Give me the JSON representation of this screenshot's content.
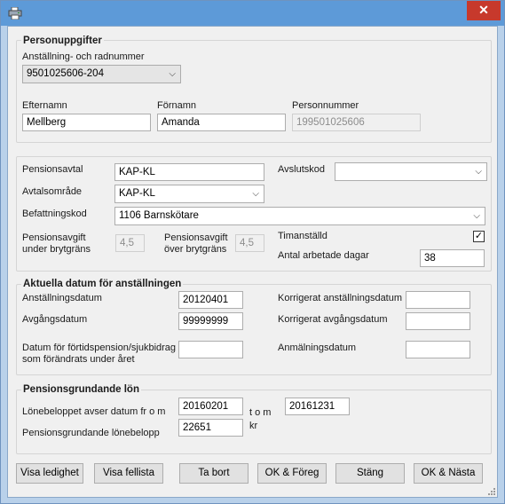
{
  "window": {
    "close_glyph": "✕",
    "app_icon": "printer-icon",
    "close_icon": "close-icon"
  },
  "personuppgifter": {
    "title": "Personuppgifter",
    "anstallning_label": "Anställning- och radnummer",
    "anstallning_value": "9501025606-204",
    "efternamn_label": "Efternamn",
    "efternamn_value": "Mellberg",
    "fornamn_label": "Förnamn",
    "fornamn_value": "Amanda",
    "personnummer_label": "Personnummer",
    "personnummer_value": "199501025606"
  },
  "pension": {
    "avtal_label": "Pensionsavtal",
    "avtal_value": "KAP-KL",
    "avslutskod_label": "Avslutskod",
    "avslutskod_value": "",
    "avtalsomrade_label": "Avtalsområde",
    "avtalsomrade_value": "KAP-KL",
    "befattning_label": "Befattningskod",
    "befattning_value": "1106 Barnskötare",
    "avgift_under_label": "Pensionsavgift under brytgräns",
    "avgift_under_value": "4,5",
    "avgift_over_label": "Pensionsavgift över brytgräns",
    "avgift_over_value": "4,5",
    "timanstalld_label": "Timanställd",
    "timanstalld_checked": true,
    "timanstalld_glyph": "✓",
    "arbetsdagar_label": "Antal arbetade dagar",
    "arbetsdagar_value": "38"
  },
  "datum": {
    "title": "Aktuella datum för anställningen",
    "anstallningsdatum_label": "Anställningsdatum",
    "anstallningsdatum_value": "20120401",
    "korr_anst_label": "Korrigerat anställningsdatum",
    "korr_anst_value": "",
    "avgangsdatum_label": "Avgångsdatum",
    "avgangsdatum_value": "99999999",
    "korr_avg_label": "Korrigerat avgångsdatum",
    "korr_avg_value": "",
    "fortidspension_label": "Datum för förtidspension/sjukbidrag som förändrats under året",
    "fortidspension_value": "",
    "anmalningsdatum_label": "Anmälningsdatum",
    "anmalningsdatum_value": ""
  },
  "lon": {
    "title": "Pensionsgrundande lön",
    "datum_from_label": "Lönebeloppet avser datum fr o m",
    "datum_from_value": "20160201",
    "tom_label": "t o m",
    "datum_tom_value": "20161231",
    "belopp_label": "Pensionsgrundande lönebelopp",
    "belopp_value": "22651",
    "kr_label": "kr"
  },
  "buttons": {
    "visa_ledighet": "Visa ledighet",
    "visa_fellista": "Visa fellista",
    "ta_bort": "Ta bort",
    "ok_foreg": "OK & Föreg",
    "stang": "Stäng",
    "ok_nasta": "OK & Nästa"
  }
}
